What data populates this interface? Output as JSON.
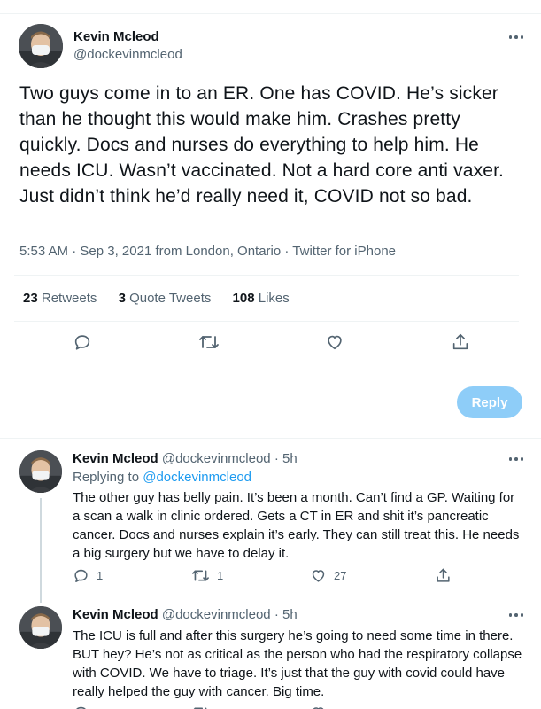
{
  "main_tweet": {
    "author": "Kevin Mcleod",
    "handle": "@dockevinmcleod",
    "text": "Two guys come in to an ER. One has COVID. He’s sicker than he thought this would make him. Crashes pretty quickly. Docs and nurses do everything to help him. He needs ICU. Wasn’t vaccinated. Not a hard core anti vaxer. Just didn’t think he’d really need it, COVID not so bad.",
    "time": "5:53 AM",
    "date": "Sep 3, 2021",
    "location": "from London, Ontario",
    "source": "Twitter for iPhone",
    "sep": "·",
    "stats": {
      "retweets_count": "23",
      "retweets_label": "Retweets",
      "quotes_count": "3",
      "quotes_label": "Quote Tweets",
      "likes_count": "108",
      "likes_label": "Likes"
    }
  },
  "reply_button": "Reply",
  "replies": [
    {
      "author": "Kevin Mcleod",
      "handle": "@dockevinmcleod",
      "age": "5h",
      "replying_prefix": "Replying to",
      "replying_to": "@dockevinmcleod",
      "text": "The other guy has belly pain. It’s been a month. Can’t find a GP. Waiting for a scan a walk in clinic ordered. Gets a CT in ER and shit it’s pancreatic cancer. Docs and nurses  explain it’s early. They can still treat this. He needs a big surgery but we have to delay it.",
      "reply_count": "1",
      "retweet_count": "1",
      "like_count": "27"
    },
    {
      "author": "Kevin Mcleod",
      "handle": "@dockevinmcleod",
      "age": "5h",
      "text": "The ICU is full and after this surgery he’s going to need some time in there. BUT hey? He’s not as critical as the person who had the respiratory collapse with COVID. We have to triage. It’s just that the guy with covid could have really helped the guy with cancer. Big time."
    }
  ],
  "colors": {
    "accent": "#1d9bf0",
    "reply_button_bg": "#8ecdf8",
    "text_secondary": "#536471"
  }
}
